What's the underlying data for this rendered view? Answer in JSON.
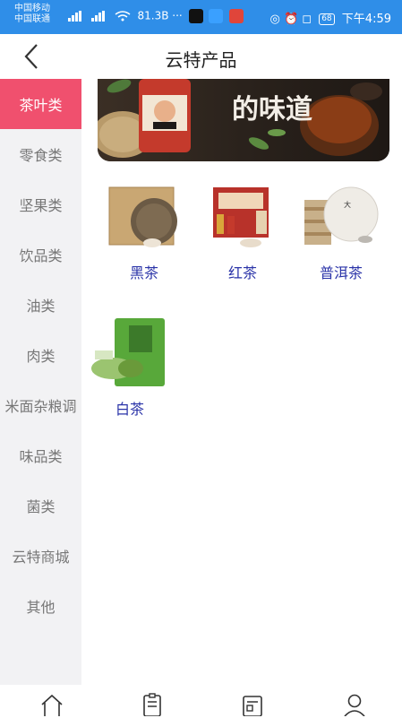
{
  "status_bar": {
    "carrier1": "中国移动",
    "carrier2": "中国联通",
    "speed": "81.3B",
    "battery": "68",
    "time": "下午4:59"
  },
  "header": {
    "title": "云特产品"
  },
  "banner": {
    "text": "的味道"
  },
  "sidebar": {
    "items": [
      {
        "label": "茶叶类"
      },
      {
        "label": "零食类"
      },
      {
        "label": "坚果类"
      },
      {
        "label": "饮品类"
      },
      {
        "label": "油类"
      },
      {
        "label": "肉类"
      },
      {
        "label": "米面杂粮调"
      },
      {
        "label": "味品类"
      },
      {
        "label": "菌类"
      },
      {
        "label": "云特商城"
      },
      {
        "label": "其他"
      }
    ]
  },
  "products": [
    {
      "name": "黑茶"
    },
    {
      "name": "红茶"
    },
    {
      "name": "普洱茶"
    },
    {
      "name": "白茶"
    }
  ],
  "bottom_nav": {
    "icons": [
      "home-icon",
      "list-icon",
      "news-icon",
      "user-icon"
    ]
  },
  "colors": {
    "status_bar": "#2f8ee8",
    "active_category": "#f0506e",
    "sidebar_bg": "#f2f2f4",
    "product_name": "#2a33a8"
  }
}
